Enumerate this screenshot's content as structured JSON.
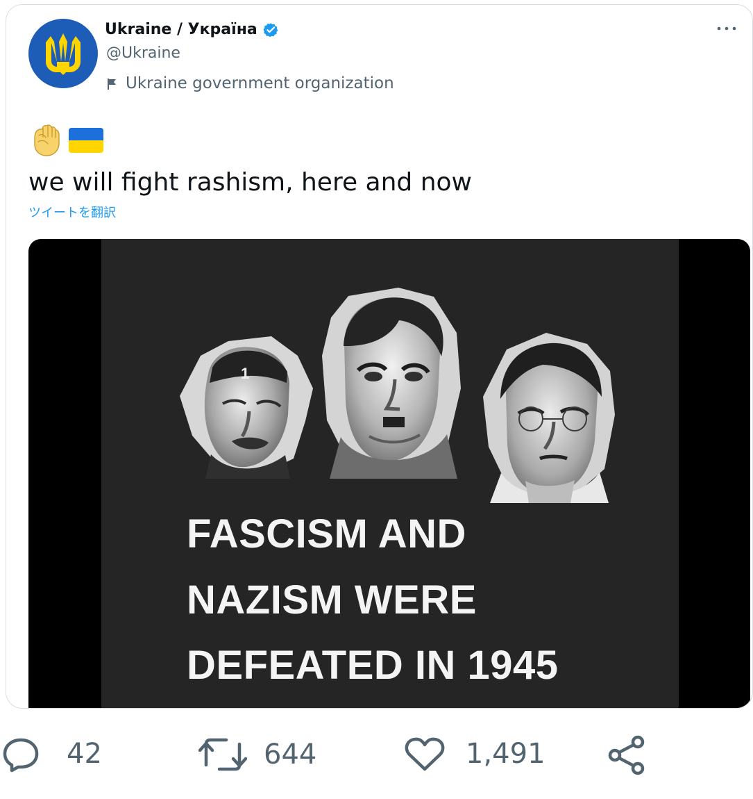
{
  "tweet": {
    "author": {
      "display_name": "Ukraine / Україна",
      "handle": "@Ukraine",
      "label": "Ukraine government organization",
      "avatar_icon": "ukraine-trident-icon",
      "verified_icon": "verified-badge-icon"
    },
    "menu_icon": "more-options-icon",
    "emojis": [
      "raised-fist-icon",
      "ukraine-flag-icon"
    ],
    "text": "we will fight rashism, here and now",
    "translate_link": "ツイートを翻訳",
    "media": {
      "headline_lines": [
        "FASCISM AND",
        "NAZISM WERE",
        "DEFEATED IN 1945"
      ],
      "portrait_icons": [
        "portrait-left",
        "portrait-center",
        "portrait-right"
      ]
    },
    "actions": {
      "reply": {
        "icon": "reply-icon",
        "count": "42"
      },
      "retweet": {
        "icon": "retweet-icon",
        "count": "644"
      },
      "like": {
        "icon": "heart-icon",
        "count": "1,491"
      },
      "share": {
        "icon": "share-icon"
      }
    }
  },
  "colors": {
    "twitter_blue": "#1d9bf0",
    "secondary_text": "#536471",
    "ukraine_blue": "#1d5db8",
    "ukraine_yellow": "#ffd500",
    "media_panel": "#252525"
  }
}
